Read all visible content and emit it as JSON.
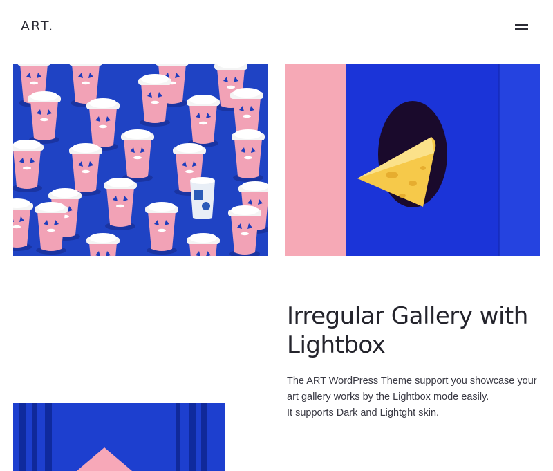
{
  "header": {
    "logo": "ART.",
    "menu_icon": "hamburger-menu-icon"
  },
  "gallery": {
    "items": [
      {
        "name": "gallery-image-coffee-cups",
        "subject": "pink paper coffee cups on blue background"
      },
      {
        "name": "gallery-image-cheese",
        "subject": "cheese wedge poking through blue wall with pink panel"
      },
      {
        "name": "gallery-image-blue-panels",
        "subject": "blue striped panels with pink shape"
      }
    ]
  },
  "section": {
    "title": "Irregular Gallery with Lightbox",
    "description_line1": "The ART WordPress Theme support you showcase your art gallery works by the Lightbox mode easily.",
    "description_line2": "It supports Dark and Lightght skin."
  },
  "colors": {
    "blue": "#1c3fbf",
    "pink": "#f0a3b4",
    "text_dark": "#24242c"
  }
}
